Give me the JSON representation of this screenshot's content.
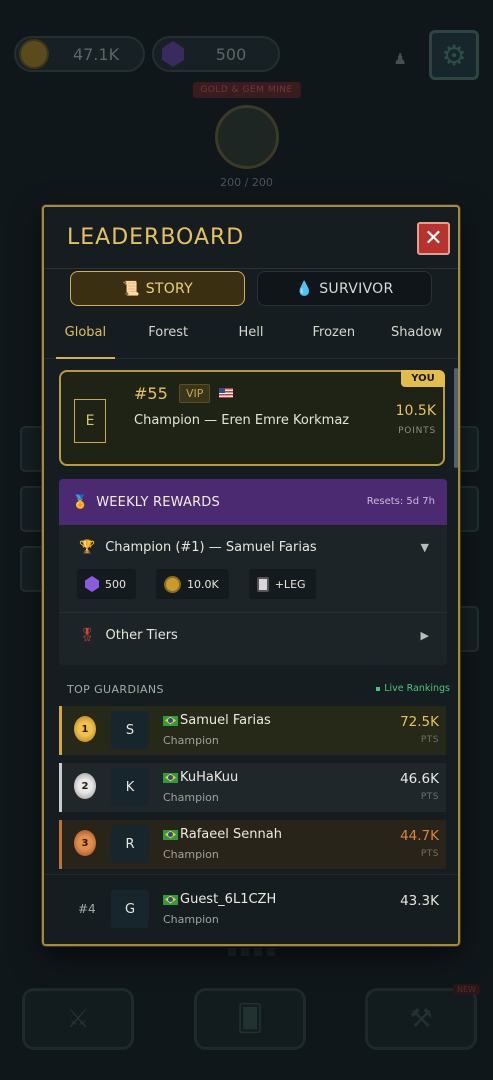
{
  "background": {
    "gold_amount": "47.1K",
    "gem_amount": "500",
    "mine_label": "GOLD & GEM MINE",
    "mine_capacity": "200 / 200",
    "new_badge": "NEW"
  },
  "header": {
    "title": "LEADERBOARD",
    "close_label": "✕"
  },
  "mode_tabs": [
    {
      "label": "STORY",
      "icon": "scroll-icon",
      "active": true
    },
    {
      "label": "SURVIVOR",
      "icon": "blood-drop-icon",
      "active": false
    }
  ],
  "region_tabs": [
    {
      "label": "Global",
      "active": true
    },
    {
      "label": "Forest",
      "active": false
    },
    {
      "label": "Hell",
      "active": false
    },
    {
      "label": "Frozen",
      "active": false
    },
    {
      "label": "Shadow",
      "active": false
    }
  ],
  "you": {
    "tag": "YOU",
    "avatar_letter": "E",
    "rank": "#55",
    "vip": "VIP",
    "name": "Champion — Eren Emre Korkmaz",
    "score": "10.5K",
    "unit": "POINTS"
  },
  "weekly_rewards": {
    "title": "WEEKLY REWARDS",
    "resets": "Resets: 5d 7h",
    "champion_tier": "Champion (#1) — Samuel Farias",
    "rewards": [
      {
        "icon": "gem-icon",
        "label": "500"
      },
      {
        "icon": "coin-icon",
        "label": "10.0K"
      },
      {
        "icon": "card-icon",
        "label": "+LEG"
      }
    ],
    "other_tiers": "Other Tiers"
  },
  "top_guardians": {
    "title": "TOP GUARDIANS",
    "live": "Live Rankings",
    "players": [
      {
        "rank": "1",
        "medal": "gold",
        "letter": "S",
        "name": "Samuel Farias",
        "title": "Champion",
        "score": "72.5K",
        "unit": "PTS"
      },
      {
        "rank": "2",
        "medal": "silver",
        "letter": "K",
        "name": "KuHaKuu",
        "title": "Champion",
        "score": "46.6K",
        "unit": "PTS"
      },
      {
        "rank": "3",
        "medal": "bronze",
        "letter": "R",
        "name": "Rafaeel Sennah",
        "title": "Champion",
        "score": "44.7K",
        "unit": "PTS"
      },
      {
        "rank": "#4",
        "medal": "none",
        "letter": "G",
        "name": "Guest_6L1CZH",
        "title": "Champion",
        "score": "43.3K",
        "unit": ""
      }
    ]
  },
  "colors": {
    "accent_gold": "#e7c25c",
    "rewards_purple": "#4c2a72",
    "close_red": "#b8322e",
    "live_green": "#49c76c",
    "bronze": "#e0823e"
  }
}
